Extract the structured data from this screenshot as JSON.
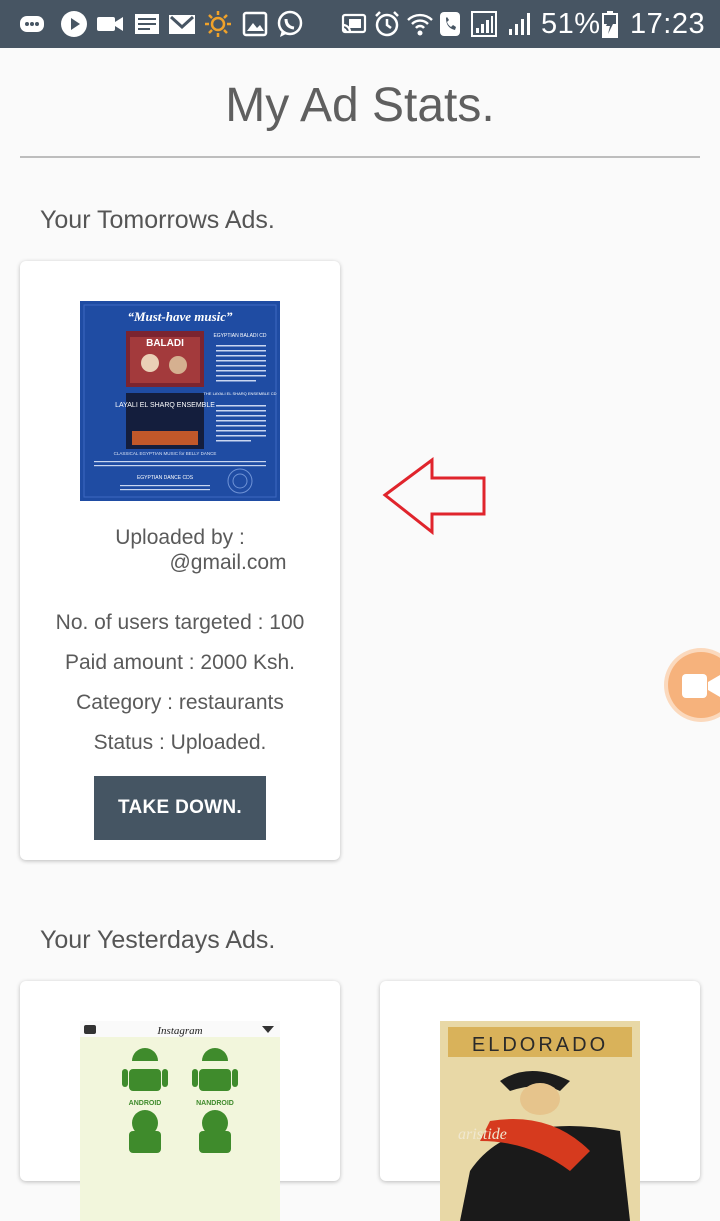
{
  "status_bar": {
    "battery": "51%",
    "time": "17:23",
    "left_icons": [
      "chat-icon",
      "play-icon",
      "video-icon",
      "news-icon",
      "gmail-icon",
      "brightness-icon",
      "gallery-icon",
      "whatsapp-icon"
    ],
    "right_icons": [
      "cast-icon",
      "alarm-icon",
      "wifi-call-icon",
      "phone-icon",
      "signal-icon",
      "signal-icon",
      "battery-charging-icon"
    ]
  },
  "page": {
    "title": "My Ad Stats."
  },
  "sections": {
    "tomorrow": {
      "title": "Your Tomorrows Ads."
    },
    "yesterday": {
      "title": "Your Yesterdays Ads."
    }
  },
  "tomorrow_ad": {
    "uploaded_by_label": "Uploaded by :",
    "uploaded_by_value": "@gmail.com",
    "users_targeted": "No. of users targeted : 100",
    "paid_amount": "Paid amount : 2000 Ksh.",
    "category": "Category : restaurants",
    "status": "Status : Uploaded.",
    "take_down_label": "TAKE DOWN.",
    "poster": {
      "headline": "“Must-have music”",
      "title1": "BALADI",
      "title2": "LAYALI EL SHARQ ENSEMBLE",
      "side1": "EGYPTIAN BALADI CD",
      "side2": "THE LAYALI EL SHARQ ENSEMBLE CD",
      "caption": "CLASSICAL EGYPTIAN MUSIC for BELLY DANCE",
      "footer": "EGYPTIAN DANCE CDS"
    }
  },
  "yesterday_ads": [
    {
      "header": "Instagram",
      "tiles": [
        "ANDROID",
        "NANDROID"
      ]
    },
    {
      "word1": "ELDORADO",
      "word2": "aristide"
    }
  ],
  "colors": {
    "statusbar": "#475563",
    "button": "#455563",
    "arrow": "#e0242c",
    "fab": "#f6b27c"
  }
}
